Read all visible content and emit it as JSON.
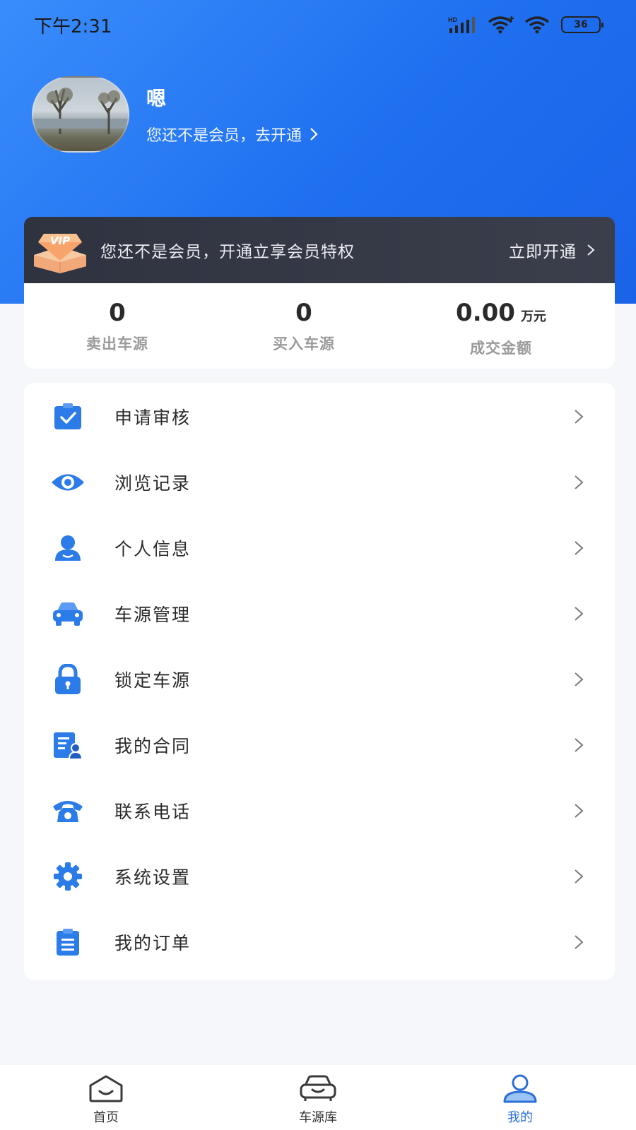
{
  "status_bar": {
    "time": "下午2:31",
    "network_label": "HD",
    "battery": "36"
  },
  "profile": {
    "username": "嗯",
    "member_prompt": "您还不是会员，去开通"
  },
  "vip_banner": {
    "badge_text": "VIP",
    "message": "您还不是会员，开通立享会员特权",
    "action_label": "立即开通"
  },
  "stats": [
    {
      "value": "0",
      "unit": "",
      "label": "卖出车源"
    },
    {
      "value": "0",
      "unit": "",
      "label": "买入车源"
    },
    {
      "value": "0.00",
      "unit": "万元",
      "label": "成交金额"
    }
  ],
  "menu": [
    {
      "label": "申请审核",
      "icon": "clipboard-check-icon"
    },
    {
      "label": "浏览记录",
      "icon": "eye-icon"
    },
    {
      "label": "个人信息",
      "icon": "person-icon"
    },
    {
      "label": "车源管理",
      "icon": "car-icon"
    },
    {
      "label": "锁定车源",
      "icon": "lock-icon"
    },
    {
      "label": "我的合同",
      "icon": "contract-icon"
    },
    {
      "label": "联系电话",
      "icon": "phone-icon"
    },
    {
      "label": "系统设置",
      "icon": "gear-icon"
    },
    {
      "label": "我的订单",
      "icon": "order-list-icon"
    }
  ],
  "tabbar": {
    "tabs": [
      {
        "label": "首页",
        "icon": "home-icon",
        "active": false
      },
      {
        "label": "车源库",
        "icon": "car-library-icon",
        "active": false
      },
      {
        "label": "我的",
        "icon": "profile-icon",
        "active": true
      }
    ]
  },
  "colors": {
    "header_blue": "#1f6ff0",
    "icon_blue": "#2b7be8",
    "vip_bar": "#3b3f4c",
    "active_tab": "#2a6fd8"
  }
}
